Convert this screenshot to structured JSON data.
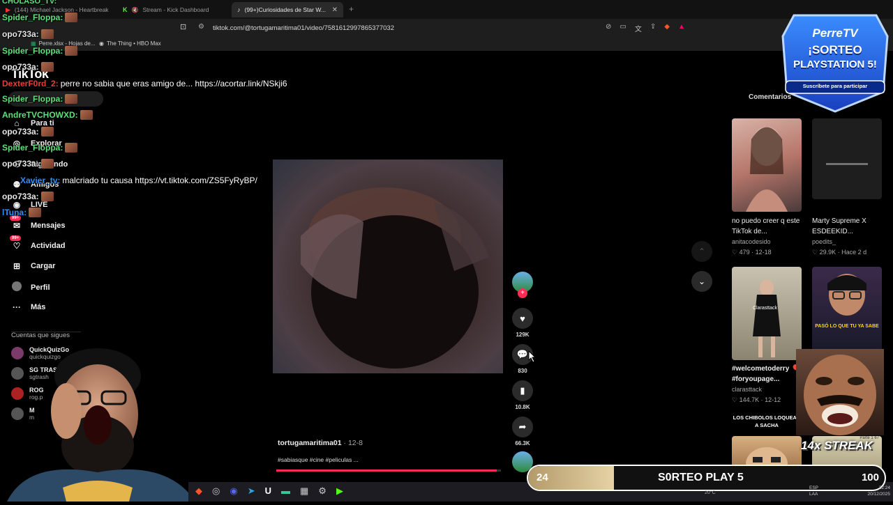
{
  "browser": {
    "tabs": [
      {
        "label": "(144) Michael Jackson - Heartbreak",
        "active": false
      },
      {
        "label": "Stream - Kick Dashboard",
        "active": false
      },
      {
        "label": "(99+)Curiosidades de Star W...",
        "active": true
      }
    ],
    "new_tab_glyph": "+",
    "url": "tiktok.com/@tortugamaritima01/video/7581612997865377032",
    "bookmarks": [
      "Perre.xlsx - Hojas de...",
      "The Thing • HBO Max"
    ]
  },
  "sidebar": {
    "logo": "TikTok",
    "nav": [
      {
        "label": "Para ti",
        "icon": "home-icon"
      },
      {
        "label": "Explorar",
        "icon": "compass-icon"
      },
      {
        "label": "Siguiendo",
        "icon": "following-icon"
      },
      {
        "label": "Amigos",
        "icon": "friends-icon"
      },
      {
        "label": "LIVE",
        "icon": "live-icon"
      },
      {
        "label": "Mensajes",
        "icon": "message-icon",
        "badge": "99+"
      },
      {
        "label": "Actividad",
        "icon": "activity-icon",
        "badge": "99+"
      },
      {
        "label": "Cargar",
        "icon": "upload-icon"
      },
      {
        "label": "Perfil",
        "icon": "profile-icon"
      },
      {
        "label": "Más",
        "icon": "more-icon"
      }
    ],
    "following_title": "Cuentas que sigues",
    "following": [
      {
        "name": "QuickQuizGo",
        "handle": "quickquizgo"
      },
      {
        "name": "SG TRASH",
        "handle": "sgtrash"
      },
      {
        "name": "ROG",
        "handle": "rog.p"
      },
      {
        "name": "M",
        "handle": "m"
      }
    ]
  },
  "chat": {
    "header": "CHOLASO_TV:",
    "messages": [
      {
        "user": "Spider_Floppa:",
        "color": "#5fe07a",
        "text": ""
      },
      {
        "user": "opo733a:",
        "color": "#e6e6e6",
        "text": ""
      },
      {
        "user": "Spider_Floppa:",
        "color": "#5fe07a",
        "text": ""
      },
      {
        "user": "opo733a:",
        "color": "#e6e6e6",
        "text": ""
      },
      {
        "user": "DexterF0rd_2:",
        "color": "#e0403a",
        "text": "perre no sabia que eras amigo de... https://acortar.link/NSkji6"
      },
      {
        "user": "Spider_Floppa:",
        "color": "#5fe07a",
        "text": ""
      },
      {
        "user": "AndreTVCHOWXD:",
        "color": "#5fe07a",
        "text": ""
      },
      {
        "user": "opo733a:",
        "color": "#e6e6e6",
        "text": ""
      },
      {
        "user": "Spider_Floppa:",
        "color": "#5fe07a",
        "text": ""
      },
      {
        "user": "opo733a:",
        "color": "#e6e6e6",
        "text": ""
      },
      {
        "user": "Xavier_tv:",
        "color": "#2f8fff",
        "text": "malcriado tu causa https://vt.tiktok.com/ZS5FyRyBP/"
      },
      {
        "user": "opo733a:",
        "color": "#e6e6e6",
        "text": ""
      },
      {
        "user": "lTuna:",
        "color": "#2f8fff",
        "text": ""
      }
    ]
  },
  "video": {
    "author": "tortugamaritima01",
    "date": "12-8",
    "caption": "#sabiasque #cine #peliculas ...",
    "progress": 0.98,
    "likes": "129K",
    "comments": "830",
    "saves": "10.8K",
    "shares": "66.3K"
  },
  "right": {
    "tab_label": "Comentarios",
    "cards": [
      {
        "title": "no puedo creer q este TikTok de...",
        "author": "anitacodesido",
        "likes": "479",
        "date": "12-18"
      },
      {
        "title": "Marty Supreme X ESDEEKID...",
        "author": "poedits_",
        "likes": "29.9K",
        "date": "Hace 2 d"
      },
      {
        "title": "#welcometoderry 🎈 #foryoupage...",
        "author": "clarasttack",
        "likes": "144.7K",
        "date": "12-12"
      },
      {
        "title": "",
        "author": "",
        "likes": "",
        "date": ""
      }
    ],
    "thumb_texts": {
      "clara": "Clarasttack",
      "paso": "PASÓ LO QUE TU YA SABE",
      "chibolos": "LOS CHIBOLOS LOQUEAN A SACHA",
      "parte": "Parte 1 67"
    }
  },
  "overlay": {
    "brand": "PerreTV",
    "promo_line1": "¡SORTEO",
    "promo_line2": "PLAYSTATION 5!",
    "promo_sub": "Suscríbete para participar",
    "streak": "14x STREAK",
    "goal_current": "24",
    "goal_label": "S0RTEO PLAY 5",
    "goal_target": "100",
    "goal_fraction": 0.24
  },
  "taskbar": {
    "lang": "ESP",
    "lang2": "LAA",
    "time": "22:24",
    "date": "20/12/2025",
    "temp": "20°C"
  },
  "colors": {
    "accent": "#fe2c55",
    "chat_green": "#5fe07a",
    "chat_blue": "#2f8fff"
  }
}
